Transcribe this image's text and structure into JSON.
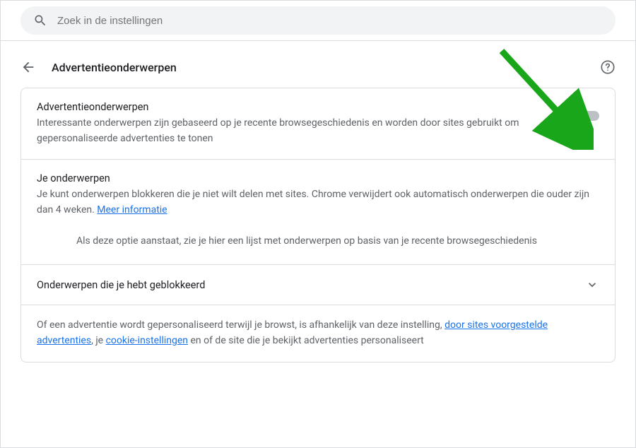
{
  "search": {
    "placeholder": "Zoek in de instellingen"
  },
  "header": {
    "title": "Advertentieonderwerpen"
  },
  "main_toggle": {
    "title": "Advertentieonderwerpen",
    "desc": "Interessante onderwerpen zijn gebaseerd op je recente browsegeschiedenis en worden door sites gebruikt om gepersonaliseerde advertenties te tonen",
    "state": "off"
  },
  "topics": {
    "title": "Je onderwerpen",
    "desc_before_link": "Je kunt onderwerpen blokkeren die je niet wilt delen met sites. Chrome verwijdert ook automatisch onderwerpen die ouder zijn dan 4 weken. ",
    "more_info_link": "Meer informatie",
    "inner_note": "Als deze optie aanstaat, zie je hier een lijst met onderwerpen op basis van je recente browsegeschiedenis"
  },
  "blocked": {
    "title": "Onderwerpen die je hebt geblokkeerd"
  },
  "footer": {
    "part1": "Of een advertentie wordt gepersonaliseerd terwijl je browst, is afhankelijk van deze instelling, ",
    "link1": "door sites voorgestelde advertenties",
    "part2": ", je ",
    "link2": "cookie-instellingen",
    "part3": " en of de site die je bekijkt advertenties personaliseert"
  }
}
